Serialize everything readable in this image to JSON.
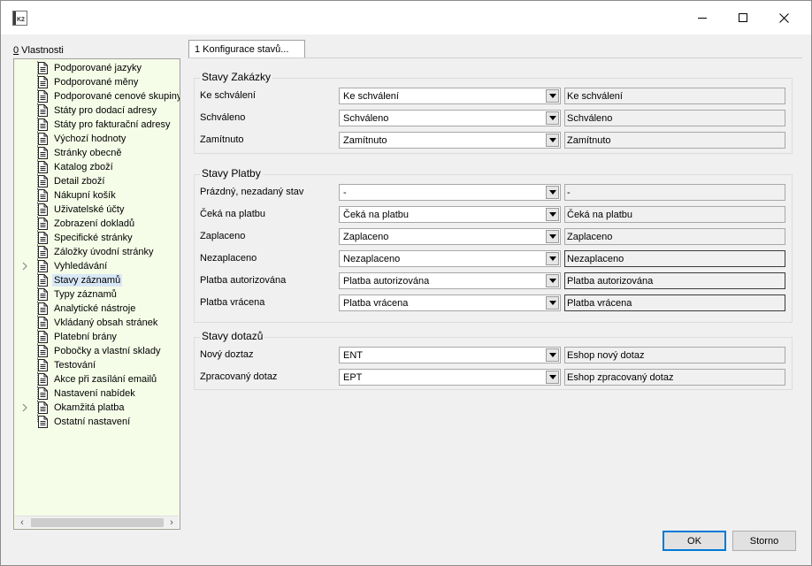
{
  "titlebar": {
    "app_icon_text": "K2",
    "controls": [
      "minimize-icon",
      "maximize-icon",
      "close-icon"
    ]
  },
  "left_panel": {
    "title_key": "0",
    "title_rest": " Vlastnosti",
    "items": [
      {
        "label": "Podporované jazyky"
      },
      {
        "label": "Podporované měny"
      },
      {
        "label": "Podporované cenové skupiny"
      },
      {
        "label": "Státy pro dodací adresy"
      },
      {
        "label": "Státy pro fakturační adresy"
      },
      {
        "label": "Výchozí hodnoty"
      },
      {
        "label": "Stránky obecně"
      },
      {
        "label": "Katalog zboží"
      },
      {
        "label": "Detail zboží"
      },
      {
        "label": "Nákupní košík"
      },
      {
        "label": "Uživatelské účty"
      },
      {
        "label": "Zobrazení dokladů"
      },
      {
        "label": "Specifické stránky"
      },
      {
        "label": "Záložky úvodní stránky"
      },
      {
        "label": "Vyhledávání",
        "expandable": true
      },
      {
        "label": "Stavy záznamů",
        "selected": true
      },
      {
        "label": "Typy záznamů"
      },
      {
        "label": "Analytické nástroje"
      },
      {
        "label": "Vkládaný obsah stránek"
      },
      {
        "label": "Platební brány"
      },
      {
        "label": "Pobočky a vlastní sklady"
      },
      {
        "label": "Testování"
      },
      {
        "label": "Akce při zasílání emailů"
      },
      {
        "label": "Nastavení nabídek"
      },
      {
        "label": "Okamžitá platba",
        "expandable": true
      },
      {
        "label": "Ostatní nastavení"
      }
    ]
  },
  "tab": {
    "label": "1 Konfigurace stavů..."
  },
  "groups": [
    {
      "title": "Stavy Zakázky",
      "rows": [
        {
          "label": "Ke schválení",
          "combo": "Ke schválení",
          "text": "Ke schválení"
        },
        {
          "label": "Schváleno",
          "combo": "Schváleno",
          "text": "Schváleno"
        },
        {
          "label": "Zamítnuto",
          "combo": "Zamítnuto",
          "text": "Zamítnuto"
        }
      ]
    },
    {
      "title": "Stavy Platby",
      "rows": [
        {
          "label": "Prázdný, nezadaný stav",
          "combo": "-",
          "text": "-"
        },
        {
          "label": "Čeká na platbu",
          "combo": "Čeká na platbu",
          "text": "Čeká na platbu"
        },
        {
          "label": "Zaplaceno",
          "combo": "Zaplaceno",
          "text": "Zaplaceno"
        },
        {
          "label": "Nezaplaceno",
          "combo": "Nezaplaceno",
          "text": "Nezaplaceno",
          "dark": true
        },
        {
          "label": "Platba autorizována",
          "combo": "Platba autorizována",
          "text": "Platba autorizována",
          "dark": true
        },
        {
          "label": "Platba vrácena",
          "combo": "Platba vrácena",
          "text": "Platba vrácena",
          "dark": true
        }
      ]
    },
    {
      "title": "Stavy dotazů",
      "rows": [
        {
          "label": "Nový doztaz",
          "combo": "ENT",
          "text": "Eshop nový dotaz"
        },
        {
          "label": "Zpracovaný dotaz",
          "combo": "EPT",
          "text": "Eshop zpracovaný dotaz"
        }
      ]
    }
  ],
  "footer": {
    "ok_label": "OK",
    "cancel_label": "Storno"
  }
}
